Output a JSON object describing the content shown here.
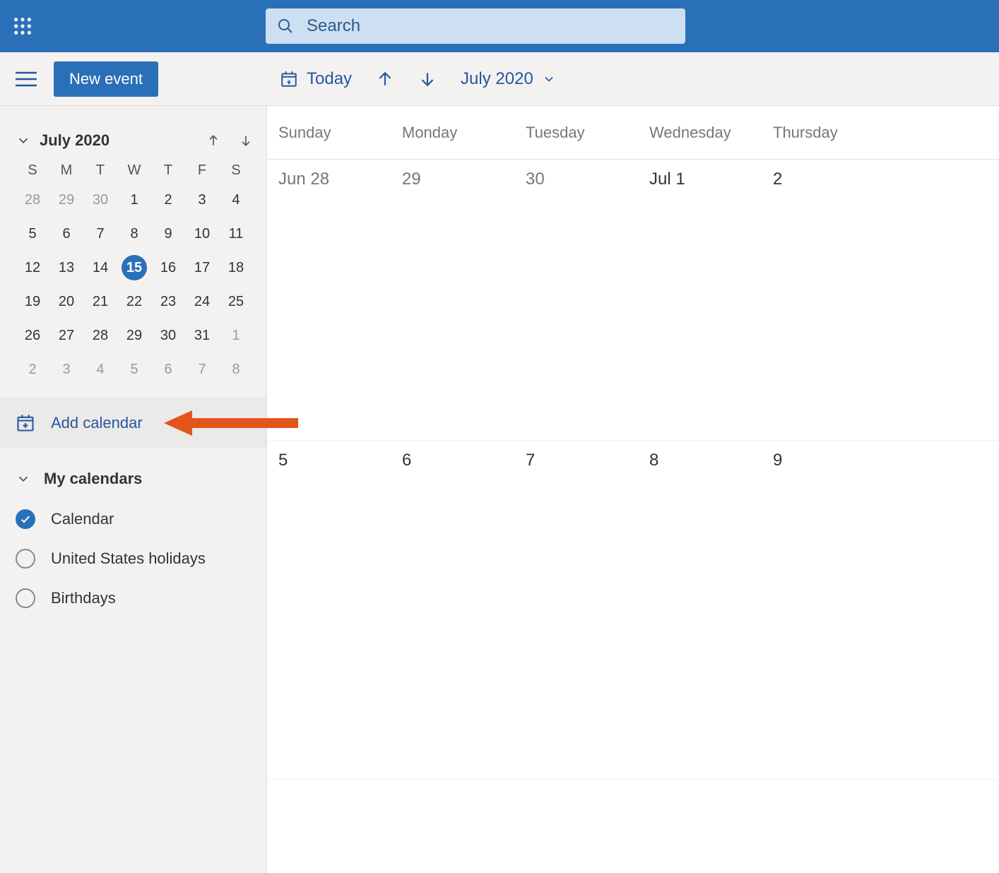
{
  "suitebar": {
    "search_placeholder": "Search"
  },
  "commands": {
    "new_event": "New event",
    "today": "Today",
    "month_label": "July 2020"
  },
  "mini_calendar": {
    "title": "July 2020",
    "dow": [
      "S",
      "M",
      "T",
      "W",
      "T",
      "F",
      "S"
    ],
    "weeks": [
      [
        {
          "d": "28",
          "other": true
        },
        {
          "d": "29",
          "other": true
        },
        {
          "d": "30",
          "other": true
        },
        {
          "d": "1"
        },
        {
          "d": "2"
        },
        {
          "d": "3"
        },
        {
          "d": "4"
        }
      ],
      [
        {
          "d": "5"
        },
        {
          "d": "6"
        },
        {
          "d": "7"
        },
        {
          "d": "8"
        },
        {
          "d": "9"
        },
        {
          "d": "10"
        },
        {
          "d": "11"
        }
      ],
      [
        {
          "d": "12"
        },
        {
          "d": "13"
        },
        {
          "d": "14"
        },
        {
          "d": "15",
          "selected": true
        },
        {
          "d": "16"
        },
        {
          "d": "17"
        },
        {
          "d": "18"
        }
      ],
      [
        {
          "d": "19"
        },
        {
          "d": "20"
        },
        {
          "d": "21"
        },
        {
          "d": "22"
        },
        {
          "d": "23"
        },
        {
          "d": "24"
        },
        {
          "d": "25"
        }
      ],
      [
        {
          "d": "26"
        },
        {
          "d": "27"
        },
        {
          "d": "28"
        },
        {
          "d": "29"
        },
        {
          "d": "30"
        },
        {
          "d": "31"
        },
        {
          "d": "1",
          "other": true
        }
      ],
      [
        {
          "d": "2",
          "other": true
        },
        {
          "d": "3",
          "other": true
        },
        {
          "d": "4",
          "other": true
        },
        {
          "d": "5",
          "other": true
        },
        {
          "d": "6",
          "other": true
        },
        {
          "d": "7",
          "other": true
        },
        {
          "d": "8",
          "other": true
        }
      ]
    ]
  },
  "add_calendar_label": "Add calendar",
  "my_calendars": {
    "heading": "My calendars",
    "items": [
      {
        "label": "Calendar",
        "checked": true
      },
      {
        "label": "United States holidays",
        "checked": false
      },
      {
        "label": "Birthdays",
        "checked": false
      }
    ]
  },
  "main_calendar": {
    "day_headers": [
      "Sunday",
      "Monday",
      "Tuesday",
      "Wednesday",
      "Thursday"
    ],
    "rows": [
      [
        "Jun 28",
        "29",
        "30",
        "Jul 1",
        "2"
      ],
      [
        "5",
        "6",
        "7",
        "8",
        "9"
      ]
    ]
  }
}
